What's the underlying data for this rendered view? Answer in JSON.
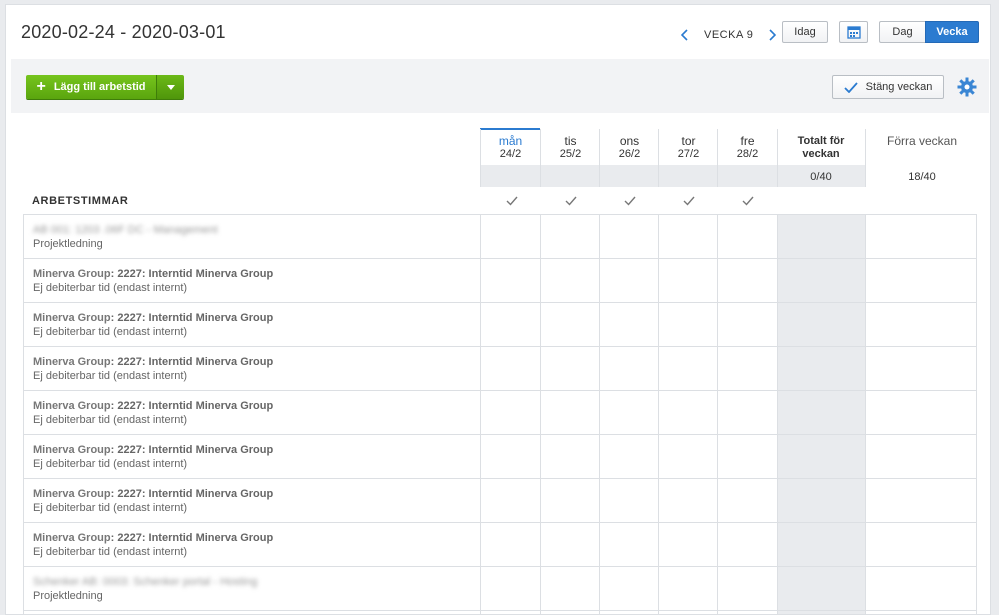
{
  "header": {
    "date_range": "2020-02-24 - 2020-03-01",
    "week_label": "VECKA 9",
    "today_label": "Idag",
    "view_day": "Dag",
    "view_week": "Vecka"
  },
  "toolbar": {
    "add_label": "Lägg till arbetstid",
    "close_week_label": "Stäng veckan"
  },
  "columns": [
    {
      "day": "mån",
      "date": "24/2"
    },
    {
      "day": "tis",
      "date": "25/2"
    },
    {
      "day": "ons",
      "date": "26/2"
    },
    {
      "day": "tor",
      "date": "27/2"
    },
    {
      "day": "fre",
      "date": "28/2"
    }
  ],
  "totals": {
    "week_label": "Totalt för veckan",
    "week_value": "0/40",
    "prev_label": "Förra veckan",
    "prev_value": "18/40"
  },
  "section_title": "ARBETSTIMMAR",
  "rows": [
    {
      "title": "AB 001: 1203 .06F DC - Management",
      "subtitle": "Projektledning",
      "blurred": true
    },
    {
      "title_prefix": "Minerva Group",
      "title": ": 2227: Interntid Minerva Group",
      "subtitle": "Ej debiterbar tid (endast internt)",
      "blurred": false
    },
    {
      "title_prefix": "Minerva Group",
      "title": ": 2227: Interntid Minerva Group",
      "subtitle": "Ej debiterbar tid (endast internt)",
      "blurred": false
    },
    {
      "title_prefix": "Minerva Group",
      "title": ": 2227: Interntid Minerva Group",
      "subtitle": "Ej debiterbar tid (endast internt)",
      "blurred": false
    },
    {
      "title_prefix": "Minerva Group",
      "title": ": 2227: Interntid Minerva Group",
      "subtitle": "Ej debiterbar tid (endast internt)",
      "blurred": false
    },
    {
      "title_prefix": "Minerva Group",
      "title": ": 2227: Interntid Minerva Group",
      "subtitle": "Ej debiterbar tid (endast internt)",
      "blurred": false
    },
    {
      "title_prefix": "Minerva Group",
      "title": ": 2227: Interntid Minerva Group",
      "subtitle": "Ej debiterbar tid (endast internt)",
      "blurred": false
    },
    {
      "title_prefix": "Minerva Group",
      "title": ": 2227: Interntid Minerva Group",
      "subtitle": "Ej debiterbar tid (endast internt)",
      "blurred": false
    },
    {
      "title": "Schenker AB: 0003: Schenker portal - Hosting",
      "subtitle": "Projektledning",
      "blurred": true
    }
  ],
  "colors": {
    "accent": "#2b7bd0",
    "add_green": "#5aa50e",
    "grey_col": "#e9ebee"
  }
}
